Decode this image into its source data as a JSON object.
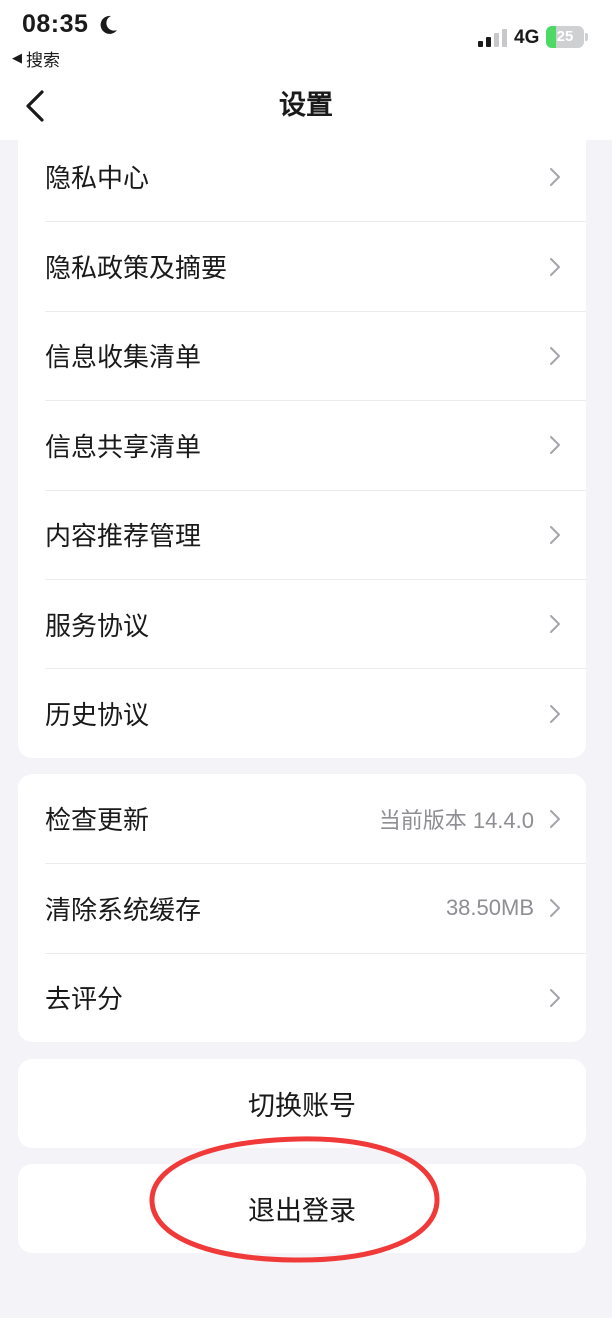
{
  "status_bar": {
    "time": "08:35",
    "back_app": "搜索",
    "network": "4G",
    "battery_level": "25",
    "battery_fraction": 0.25,
    "battery_color": "#4cd964"
  },
  "nav": {
    "title": "设置",
    "back_icon": "chevron-left-icon"
  },
  "privacy_group": [
    {
      "label": "隐私中心"
    },
    {
      "label": "隐私政策及摘要"
    },
    {
      "label": "信息收集清单"
    },
    {
      "label": "信息共享清单"
    },
    {
      "label": "内容推荐管理"
    },
    {
      "label": "服务协议"
    },
    {
      "label": "历史协议"
    }
  ],
  "app_group": [
    {
      "label": "检查更新",
      "value_prefix": "当前版本",
      "value": "14.4.0"
    },
    {
      "label": "清除系统缓存",
      "value": "38.50MB"
    },
    {
      "label": "去评分"
    }
  ],
  "actions": {
    "switch_account": "切换账号",
    "logout": "退出登录"
  },
  "colors": {
    "background": "#f3f3f8",
    "card": "#ffffff",
    "secondary_text": "#8e8e93",
    "highlight": "#f03a3a"
  }
}
